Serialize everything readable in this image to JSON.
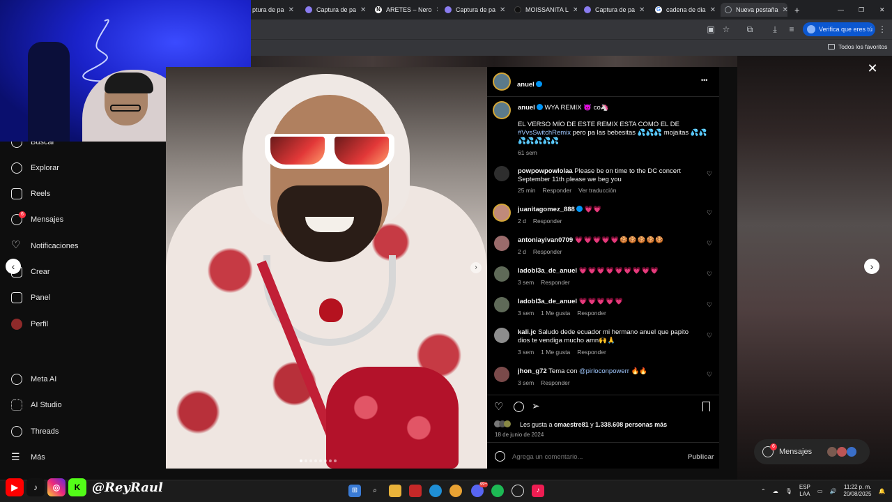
{
  "browser": {
    "tabs": [
      {
        "label": "ptura de pa",
        "color": "#8a7cf0",
        "icon": "pen-icon"
      },
      {
        "label": "Captura de pa",
        "color": "#8a7cf0",
        "icon": "pen-icon"
      },
      {
        "label": "ARETES – Nero",
        "color": "#ffffff",
        "icon": "n-icon"
      },
      {
        "label": "Captura de pa",
        "color": "#8a7cf0",
        "icon": "pen-icon"
      },
      {
        "label": "MOISSANITA L",
        "color": "#000000",
        "icon": "tiktok-icon"
      },
      {
        "label": "Captura de pa",
        "color": "#8a7cf0",
        "icon": "pen-icon"
      },
      {
        "label": "cadena de dia",
        "color": "#4285f4",
        "icon": "google-icon"
      },
      {
        "label": "Nueva pestaña",
        "color": "#9aa0a6",
        "icon": "globe-icon"
      }
    ],
    "new_tab": "+",
    "verify_label": "Verifica que eres tú",
    "bookmarks_label": "Todos los favoritos"
  },
  "sidebar": {
    "items": [
      {
        "label": "Buscar",
        "icon": "search-icon"
      },
      {
        "label": "Explorar",
        "icon": "compass-icon"
      },
      {
        "label": "Reels",
        "icon": "reels-icon"
      },
      {
        "label": "Mensajes",
        "icon": "messenger-icon",
        "badge": "6"
      },
      {
        "label": "Notificaciones",
        "icon": "heart-icon"
      },
      {
        "label": "Crear",
        "icon": "plus-icon"
      },
      {
        "label": "Panel",
        "icon": "chart-icon"
      },
      {
        "label": "Perfil",
        "icon": "avatar-icon"
      },
      {
        "label": "Meta AI",
        "icon": "meta-ai-icon"
      },
      {
        "label": "AI Studio",
        "icon": "ai-studio-icon"
      },
      {
        "label": "Threads",
        "icon": "threads-icon"
      },
      {
        "label": "Más",
        "icon": "menu-icon"
      }
    ]
  },
  "post": {
    "author": "anuel",
    "more": "•••",
    "caption": {
      "username": "anuel",
      "line1": "WYA REMIX 👿 co🦄",
      "line2": "EL VERSO MÍO DE ESTE REMIX ESTA COMO EL DE",
      "hashtag": "#VvsSwitchRemix",
      "line3": " pero pa las bebesitas 💦💦💦 mojaitas 💦💦",
      "line4": "💦💦💦💦💦",
      "time": "61 sem"
    },
    "comments": [
      {
        "username": "powpowpowlolaa",
        "text": "Please be on time to the DC concert September 11th please we beg you",
        "time": "25 min",
        "actions": [
          "Responder",
          "Ver traducción"
        ],
        "verified": false,
        "avatar": "#3a3a3a"
      },
      {
        "username": "juanitagomez_888",
        "text": "💗💗",
        "time": "2 d",
        "actions": [
          "Responder"
        ],
        "verified": true,
        "avatar": "#c08a7a"
      },
      {
        "username": "antoniayivan0709",
        "text": "💗💗💗💗💗🍪🍪🍪🍪🍪",
        "time": "2 d",
        "actions": [
          "Responder"
        ],
        "verified": false,
        "avatar": "#9a6b6b"
      },
      {
        "username": "ladobl3a_de_anuel",
        "text": "💗💗💗💗💗💗💗💗💗",
        "time": "3 sem",
        "actions": [
          "Responder"
        ],
        "verified": false,
        "avatar": "#5f6a58"
      },
      {
        "username": "ladobl3a_de_anuel",
        "text": "💗💗💗💗💗",
        "time": "3 sem",
        "actions": [
          "1 Me gusta",
          "Responder"
        ],
        "verified": false,
        "avatar": "#5f6a58"
      },
      {
        "username": "kali.jc",
        "text": "Saludo dede ecuador mi hermano anuel que papito dios te vendiga mucho amn🙌🙏",
        "time": "3 sem",
        "actions": [
          "1 Me gusta",
          "Responder"
        ],
        "verified": false,
        "avatar": "#8d8d8d"
      },
      {
        "username": "jhon_g72",
        "text": "Tema con ",
        "mention": "@pirloconpowerr",
        "emoji": " 🔥🔥",
        "time": "3 sem",
        "actions": [
          "Responder"
        ],
        "verified": false,
        "avatar": "#7a4a4a"
      }
    ],
    "likes": {
      "prefix": "Les gusta a ",
      "user": "cmaestre81",
      "middle": " y ",
      "count": "1.338.608 personas más"
    },
    "date": "18 de junio de 2024",
    "comment_placeholder": "Agrega un comentario...",
    "publish": "Publicar"
  },
  "messages_pill": {
    "label": "Mensajes",
    "badge": "6"
  },
  "overlay": {
    "handle": "@ReyRaul"
  },
  "taskbar": {
    "lang": "ESP",
    "lang2": "LAA",
    "time": "11:22 p. m.",
    "date": "20/08/2025",
    "badge": "99+"
  }
}
